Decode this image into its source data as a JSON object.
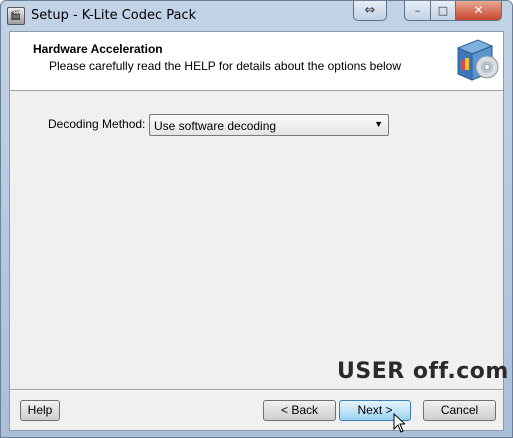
{
  "window": {
    "title": "Setup - K-Lite Codec Pack",
    "controls": {
      "restore": "⇔",
      "minimize": "–",
      "maximize": "□",
      "close": "✕"
    }
  },
  "header": {
    "title": "Hardware Acceleration",
    "subtitle": "Please carefully read the HELP for details about the options below",
    "logo_icon": "software-box-icon"
  },
  "form": {
    "decoding_label": "Decoding Method:",
    "decoding_value": "Use software decoding"
  },
  "watermark": {
    "text": "USER   off.com"
  },
  "buttons": {
    "help": "Help",
    "back": "< Back",
    "next": "Next >",
    "cancel": "Cancel"
  },
  "colors": {
    "accent": "#3c7fb1",
    "close": "#c7452f"
  }
}
